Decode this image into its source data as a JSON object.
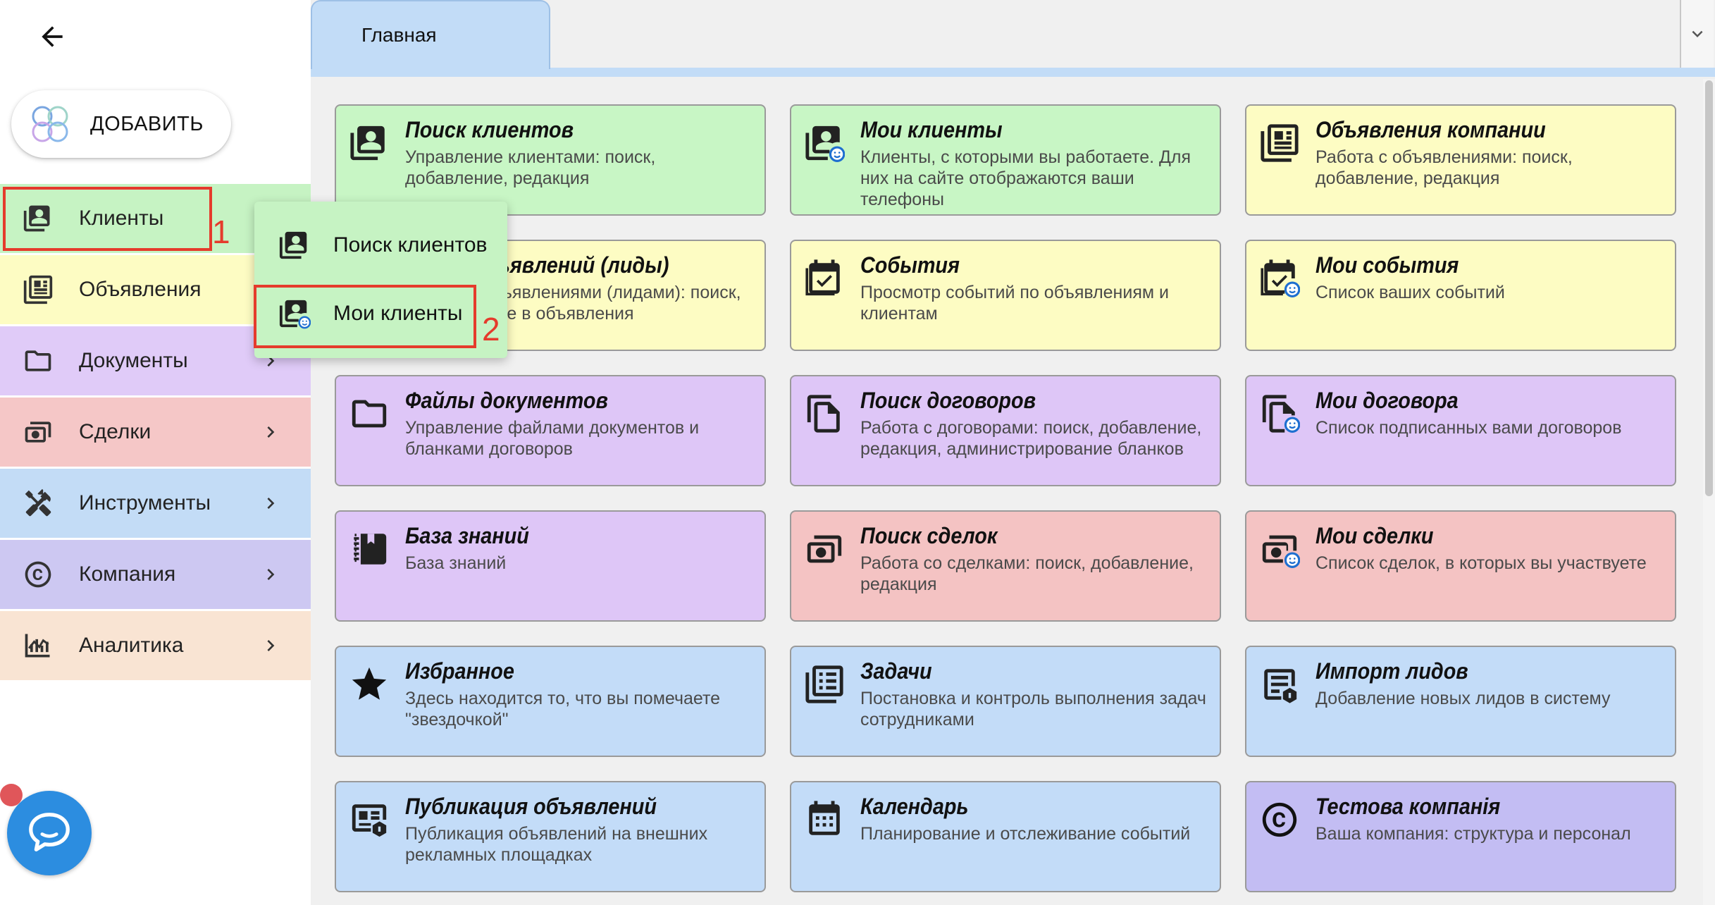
{
  "colors": {
    "highlight": "#e53b2c",
    "green": "#c8f6c5",
    "yellow": "#fdfcc3",
    "purple": "#dec6f7",
    "red": "#f4c3c3",
    "blue": "#c3dcf8",
    "indigo": "#c3bdf3",
    "peach": "#f9e4d3",
    "tab": "#c2dcf7",
    "chat": "#2c8de0"
  },
  "sidebar": {
    "back_icon": "arrow-left-icon",
    "add_button": {
      "label": "ДОБАВИТЬ",
      "icon": "app-logo-icon"
    },
    "items": [
      {
        "label": "Клиенты",
        "icon": "contacts-icon",
        "has_chevron": false
      },
      {
        "label": "Объявления",
        "icon": "listing-icon",
        "has_chevron": false
      },
      {
        "label": "Документы",
        "icon": "folder-icon",
        "has_chevron": true
      },
      {
        "label": "Сделки",
        "icon": "money-icon",
        "has_chevron": true
      },
      {
        "label": "Инструменты",
        "icon": "tools-icon",
        "has_chevron": true
      },
      {
        "label": "Компания",
        "icon": "copyright-icon",
        "has_chevron": true
      },
      {
        "label": "Аналитика",
        "icon": "analytics-icon",
        "has_chevron": true
      }
    ]
  },
  "submenu": {
    "items": [
      {
        "label": "Поиск клиентов",
        "icon": "contacts-icon"
      },
      {
        "label": "Мои клиенты",
        "icon": "my-contacts-icon"
      }
    ]
  },
  "annotations": {
    "step1": "1",
    "step2": "2"
  },
  "tabs": [
    {
      "label": "Главная",
      "active": true
    }
  ],
  "tab_dropdown_icon": "chevron-down-icon",
  "cards": [
    {
      "title": "Поиск клиентов",
      "desc": "Управление клиентами: поиск, добавление, редакция",
      "icon": "contacts-icon",
      "color": "green"
    },
    {
      "title": "Мои клиенты",
      "desc": "Клиенты, с которыми вы работаете. Для них на сайте отображаются ваши телефоны",
      "icon": "my-contacts-icon",
      "color": "green"
    },
    {
      "title": "Объявления компании",
      "desc": "Работа с объявлениями: поиск, добавление, редакция",
      "icon": "listing-icon",
      "color": "yellow"
    },
    {
      "title": "Поиск объявлений (лиды)",
      "desc": "Работа с объявлениями (лидами): поиск, превращение в объявления",
      "icon": "search-listing-icon",
      "color": "yellow"
    },
    {
      "title": "События",
      "desc": "Просмотр событий по объявлениям и клиентам",
      "icon": "event-icon",
      "color": "yellow"
    },
    {
      "title": "Мои события",
      "desc": "Список ваших событий",
      "icon": "my-event-icon",
      "color": "yellow"
    },
    {
      "title": "Файлы документов",
      "desc": "Управление файлами документов и бланками договоров",
      "icon": "folder-icon",
      "color": "purple"
    },
    {
      "title": "Поиск договоров",
      "desc": "Работа с договорами: поиск, добавление, редакция, администрирование бланков",
      "icon": "document-copy-icon",
      "color": "purple"
    },
    {
      "title": "Мои договора",
      "desc": "Список подписанных вами договоров",
      "icon": "my-document-icon",
      "color": "purple"
    },
    {
      "title": "База знаний",
      "desc": "База знаний",
      "icon": "notebook-icon",
      "color": "purple"
    },
    {
      "title": "Поиск сделок",
      "desc": "Работа со сделками: поиск, добавление, редакция",
      "icon": "money-icon",
      "color": "red"
    },
    {
      "title": "Мои сделки",
      "desc": "Список сделок, в которых вы участвуете",
      "icon": "my-money-icon",
      "color": "red"
    },
    {
      "title": "Избранное",
      "desc": "Здесь находится то, что вы помечаете \"звездочкой\"",
      "icon": "star-icon",
      "color": "blue"
    },
    {
      "title": "Задачи",
      "desc": "Постановка и контроль выполнения задач сотрудниками",
      "icon": "tasks-icon",
      "color": "blue"
    },
    {
      "title": "Импорт лидов",
      "desc": "Добавление новых лидов в систему",
      "icon": "import-icon",
      "color": "blue"
    },
    {
      "title": "Публикация объявлений",
      "desc": "Публикация объявлений на внешних рекламных площадках",
      "icon": "publish-icon",
      "color": "blue"
    },
    {
      "title": "Календарь",
      "desc": "Планирование и отслеживание событий",
      "icon": "calendar-icon",
      "color": "blue"
    },
    {
      "title": "Тестова компанія",
      "desc": "Ваша компания: структура и персонал",
      "icon": "copyright-icon",
      "color": "indigo"
    }
  ],
  "chat_button": {
    "icon": "chat-icon"
  }
}
